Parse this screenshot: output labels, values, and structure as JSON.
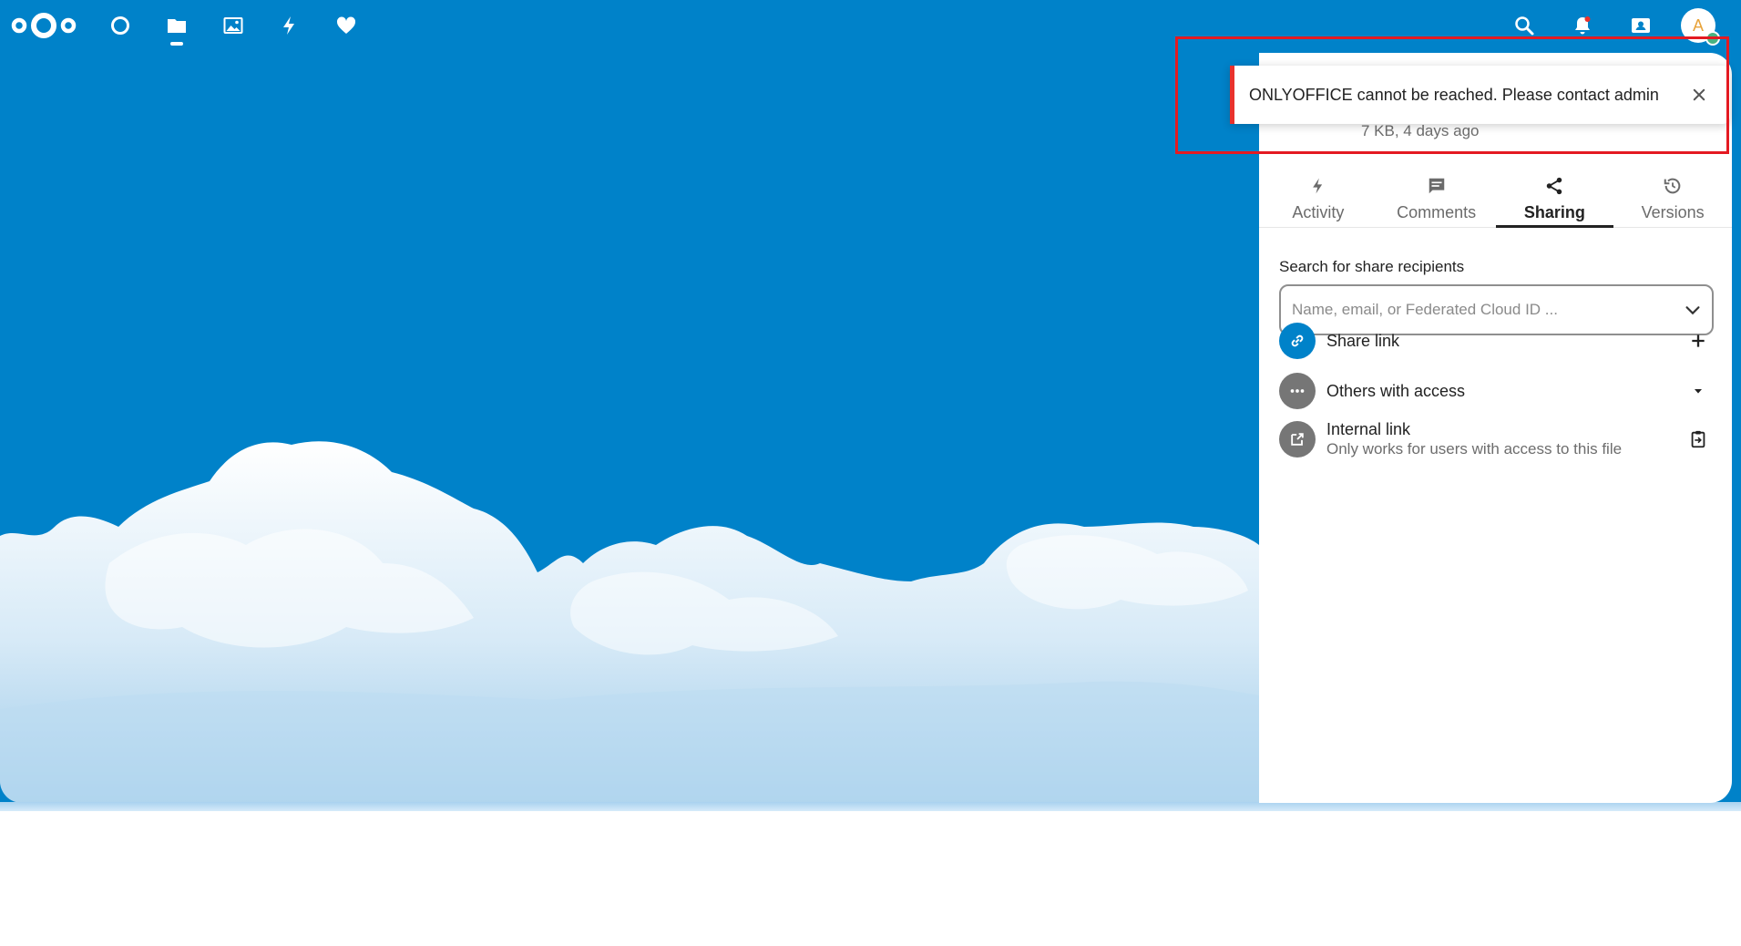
{
  "header": {
    "apps": [
      {
        "name": "Dashboard",
        "icon": "dashboard-icon"
      },
      {
        "name": "Files",
        "icon": "folder-icon",
        "active": true
      },
      {
        "name": "Photos",
        "icon": "photos-icon"
      },
      {
        "name": "Activity",
        "icon": "activity-icon"
      },
      {
        "name": "Favorites",
        "icon": "heart-icon"
      }
    ],
    "avatar_initial": "A"
  },
  "sidebar": {
    "file_meta": "7 KB, 4 days ago",
    "tabs": [
      {
        "label": "Activity",
        "icon": "bolt-icon"
      },
      {
        "label": "Comments",
        "icon": "comment-icon"
      },
      {
        "label": "Sharing",
        "icon": "share-icon",
        "active": true
      },
      {
        "label": "Versions",
        "icon": "history-icon"
      }
    ],
    "share_label": "Search for share recipients",
    "share_placeholder": "Name, email, or Federated Cloud ID ...",
    "share_link": {
      "title": "Share link"
    },
    "others": {
      "title": "Others with access"
    },
    "internal": {
      "title": "Internal link",
      "subtitle": "Only works for users with access to this file"
    }
  },
  "toast": {
    "message": "ONLYOFFICE cannot be reached. Please contact admin"
  },
  "colors": {
    "primary": "#0082c9",
    "error": "#e9322d",
    "highlight": "#e41a22"
  }
}
